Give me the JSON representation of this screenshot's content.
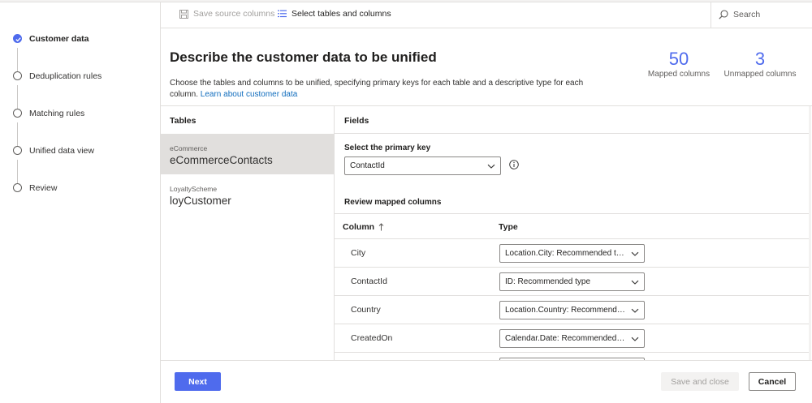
{
  "stepper": {
    "steps": [
      {
        "label": "Customer data",
        "active": true
      },
      {
        "label": "Deduplication rules",
        "active": false
      },
      {
        "label": "Matching rules",
        "active": false
      },
      {
        "label": "Unified data view",
        "active": false
      },
      {
        "label": "Review",
        "active": false
      }
    ]
  },
  "toolbar": {
    "save_source_columns": "Save source columns",
    "select_tables_and_columns": "Select tables and columns",
    "search_placeholder": "Search"
  },
  "header": {
    "title": "Describe the customer data to be unified",
    "description": "Choose the tables and columns to be unified, specifying primary keys for each table and a descriptive type for each column.",
    "learn_link": "Learn about customer data",
    "mapped": {
      "value": "50",
      "label": "Mapped columns"
    },
    "unmapped": {
      "value": "3",
      "label": "Unmapped columns"
    }
  },
  "tables_panel": {
    "heading": "Tables",
    "items": [
      {
        "group": "eCommerce",
        "name": "eCommerceContacts",
        "selected": true
      },
      {
        "group": "LoyaltyScheme",
        "name": "loyCustomer",
        "selected": false
      }
    ]
  },
  "fields_panel": {
    "heading": "Fields",
    "primary_key_label": "Select the primary key",
    "primary_key_value": "ContactId",
    "review_label": "Review mapped columns",
    "column_header": "Column",
    "type_header": "Type",
    "rows": [
      {
        "column": "City",
        "type": "Location.City: Recommended type"
      },
      {
        "column": "ContactId",
        "type": "ID: Recommended type"
      },
      {
        "column": "Country",
        "type": "Location.Country: Recommended type"
      },
      {
        "column": "CreatedOn",
        "type": "Calendar.Date: Recommended type"
      }
    ]
  },
  "footer": {
    "next": "Next",
    "save_and_close": "Save and close",
    "cancel": "Cancel"
  },
  "colors": {
    "accent": "#4f6bed",
    "link": "#0f6cbd",
    "selected_row": "#e1dfdd"
  },
  "icons": [
    "save-icon",
    "list-icon",
    "search-icon",
    "chevron-down-icon",
    "info-icon",
    "sort-up-icon",
    "checkmark-icon"
  ]
}
